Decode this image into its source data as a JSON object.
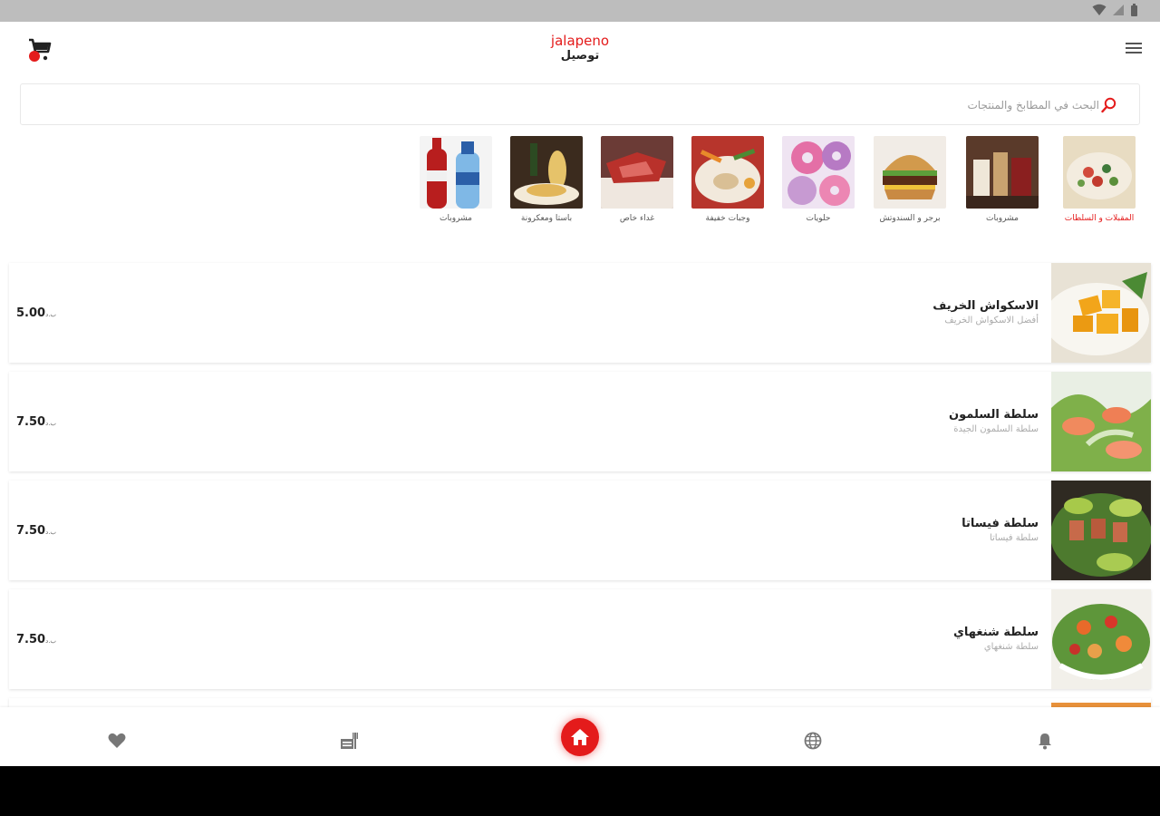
{
  "app": {
    "brand": "jalapeno",
    "subtitle": "توصيل"
  },
  "search": {
    "placeholder": "البحث في المطابخ والمنتجات"
  },
  "categories": [
    {
      "label": "المقبلات و السلطات",
      "active": true
    },
    {
      "label": "مشروبات",
      "active": false
    },
    {
      "label": "برجر و السندوتش",
      "active": false
    },
    {
      "label": "حلويات",
      "active": false
    },
    {
      "label": "وجبات خفيفة",
      "active": false
    },
    {
      "label": "غداء خاص",
      "active": false
    },
    {
      "label": "باستا ومعكرونة",
      "active": false
    },
    {
      "label": "مشروبات",
      "active": false
    }
  ],
  "items": [
    {
      "name": "الاسكواش الخريف",
      "desc": "أفضل الاسكواش الخريف",
      "price": "5.00",
      "currency": "ب.د"
    },
    {
      "name": "سلطة السلمون",
      "desc": "سلطة السلمون الجيدة",
      "price": "7.50",
      "currency": "ب.د"
    },
    {
      "name": "سلطة فيساتا",
      "desc": "سلطة فيساتا",
      "price": "7.50",
      "currency": "ب.د"
    },
    {
      "name": "سلطة شنغهاي",
      "desc": "سلطة شنغهاي",
      "price": "7.50",
      "currency": "ب.د"
    }
  ],
  "colors": {
    "accent": "#e41b1b"
  }
}
